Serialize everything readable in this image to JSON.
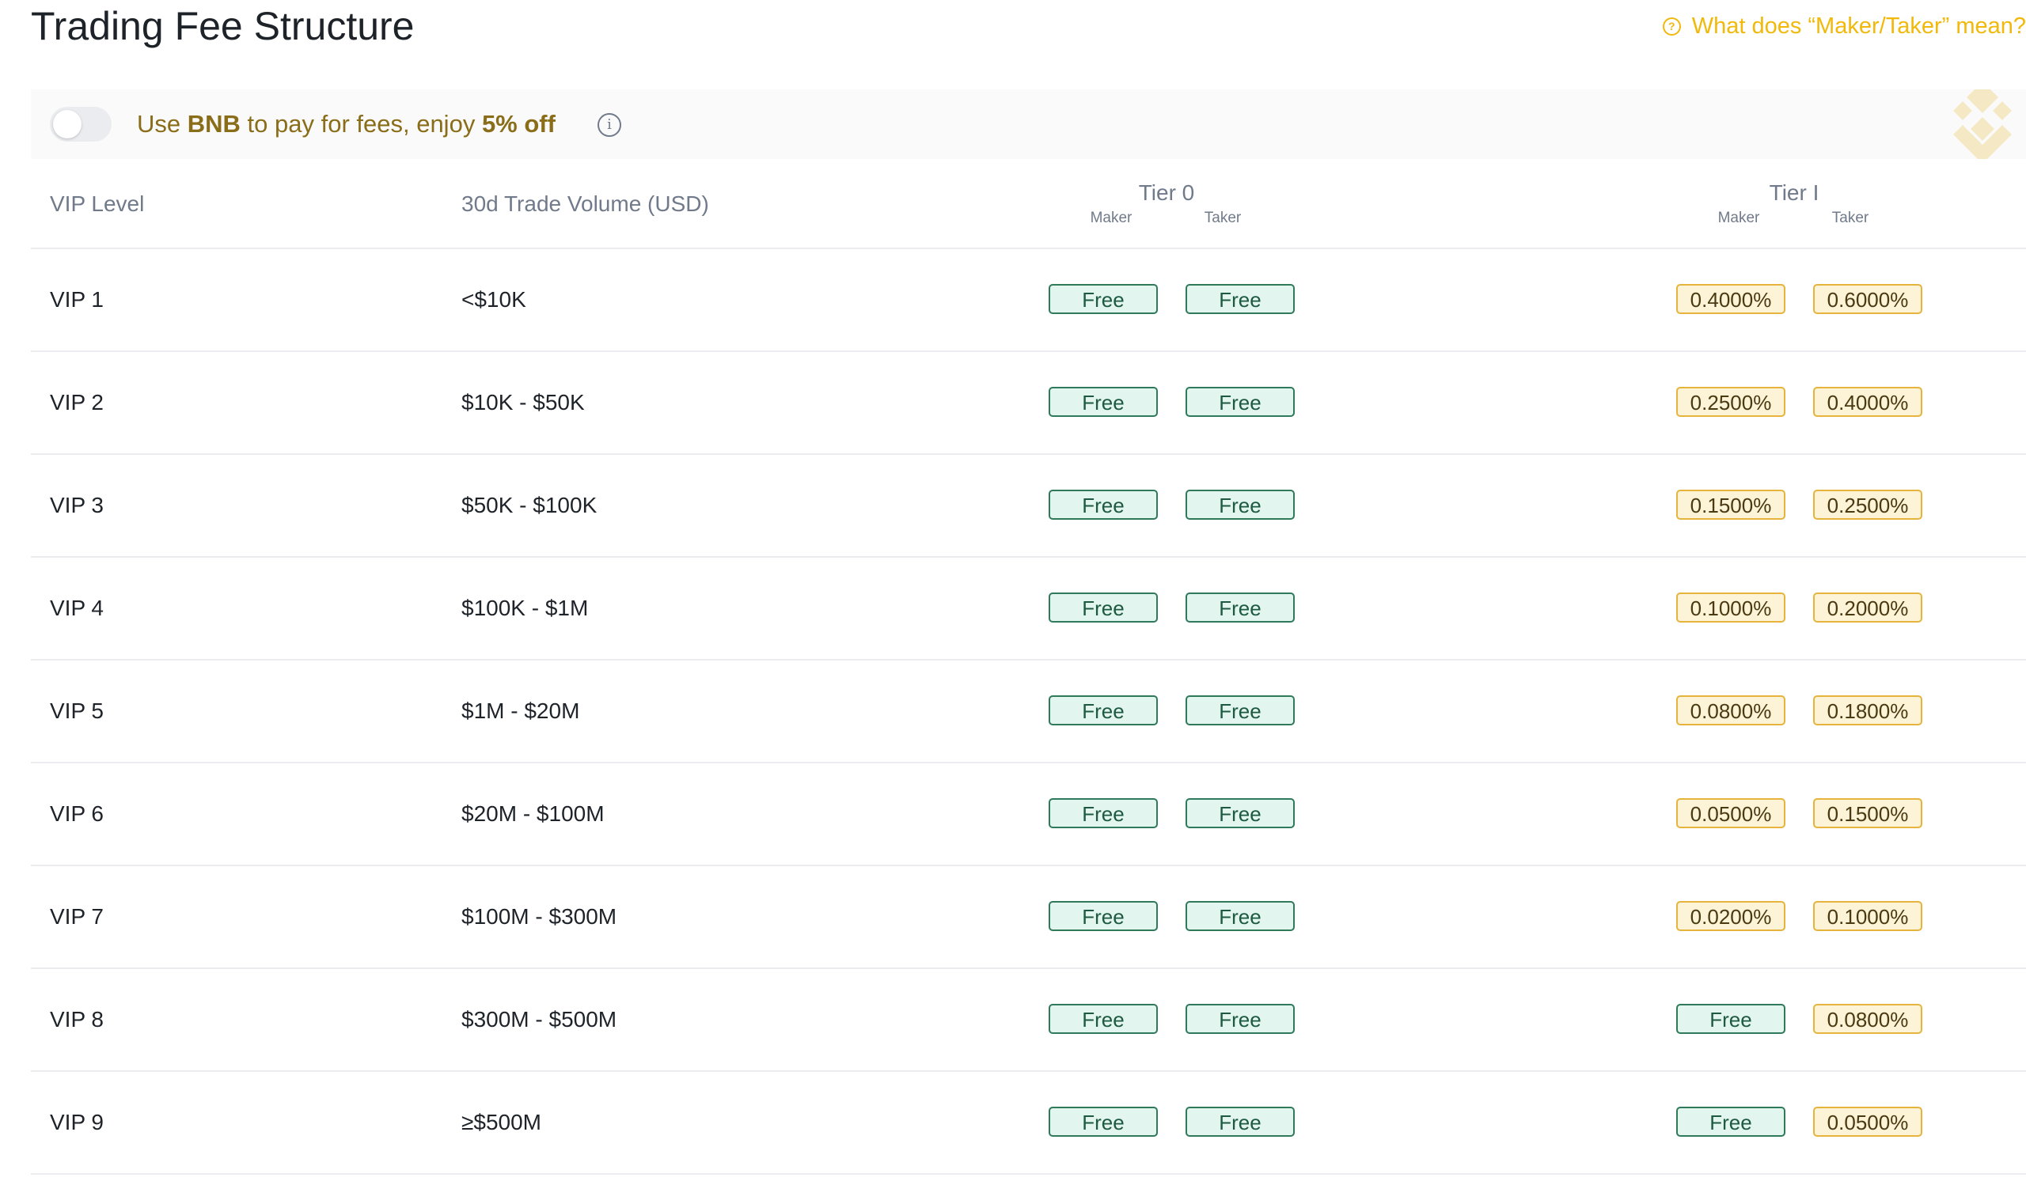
{
  "page": {
    "title": "Trading Fee Structure",
    "help_link": "What does “Maker/Taker” mean?"
  },
  "banner": {
    "text_pre": "Use ",
    "bnb": "BNB",
    "text_mid": " to pay for fees, enjoy ",
    "discount": "5% off",
    "toggle_on": false
  },
  "table": {
    "headers": {
      "vip_level": "VIP Level",
      "volume": "30d Trade Volume (USD)",
      "tier0": "Tier 0",
      "tier1": "Tier I",
      "maker": "Maker",
      "taker": "Taker"
    },
    "rows": [
      {
        "level": "VIP 1",
        "volume": "<$10K",
        "t0_maker": "Free",
        "t0_taker": "Free",
        "t1_maker": "0.4000%",
        "t1_taker": "0.6000%"
      },
      {
        "level": "VIP 2",
        "volume": "$10K - $50K",
        "t0_maker": "Free",
        "t0_taker": "Free",
        "t1_maker": "0.2500%",
        "t1_taker": "0.4000%"
      },
      {
        "level": "VIP 3",
        "volume": "$50K - $100K",
        "t0_maker": "Free",
        "t0_taker": "Free",
        "t1_maker": "0.1500%",
        "t1_taker": "0.2500%"
      },
      {
        "level": "VIP 4",
        "volume": "$100K - $1M",
        "t0_maker": "Free",
        "t0_taker": "Free",
        "t1_maker": "0.1000%",
        "t1_taker": "0.2000%"
      },
      {
        "level": "VIP 5",
        "volume": "$1M - $20M",
        "t0_maker": "Free",
        "t0_taker": "Free",
        "t1_maker": "0.0800%",
        "t1_taker": "0.1800%"
      },
      {
        "level": "VIP 6",
        "volume": "$20M - $100M",
        "t0_maker": "Free",
        "t0_taker": "Free",
        "t1_maker": "0.0500%",
        "t1_taker": "0.1500%"
      },
      {
        "level": "VIP 7",
        "volume": "$100M - $300M",
        "t0_maker": "Free",
        "t0_taker": "Free",
        "t1_maker": "0.0200%",
        "t1_taker": "0.1000%"
      },
      {
        "level": "VIP 8",
        "volume": "$300M - $500M",
        "t0_maker": "Free",
        "t0_taker": "Free",
        "t1_maker": "Free",
        "t1_taker": "0.0800%"
      },
      {
        "level": "VIP 9",
        "volume": "≥$500M",
        "t0_maker": "Free",
        "t0_taker": "Free",
        "t1_maker": "Free",
        "t1_taker": "0.0500%"
      }
    ]
  },
  "colors": {
    "accent": "#f0b90b",
    "free_bg": "#e2f5ee",
    "free_border": "#2e7a5a",
    "fee_bg": "#fdf3d6",
    "fee_border": "#e6b43c"
  },
  "icons": [
    "help-circle-icon",
    "info-icon",
    "bnb-logo-icon"
  ]
}
